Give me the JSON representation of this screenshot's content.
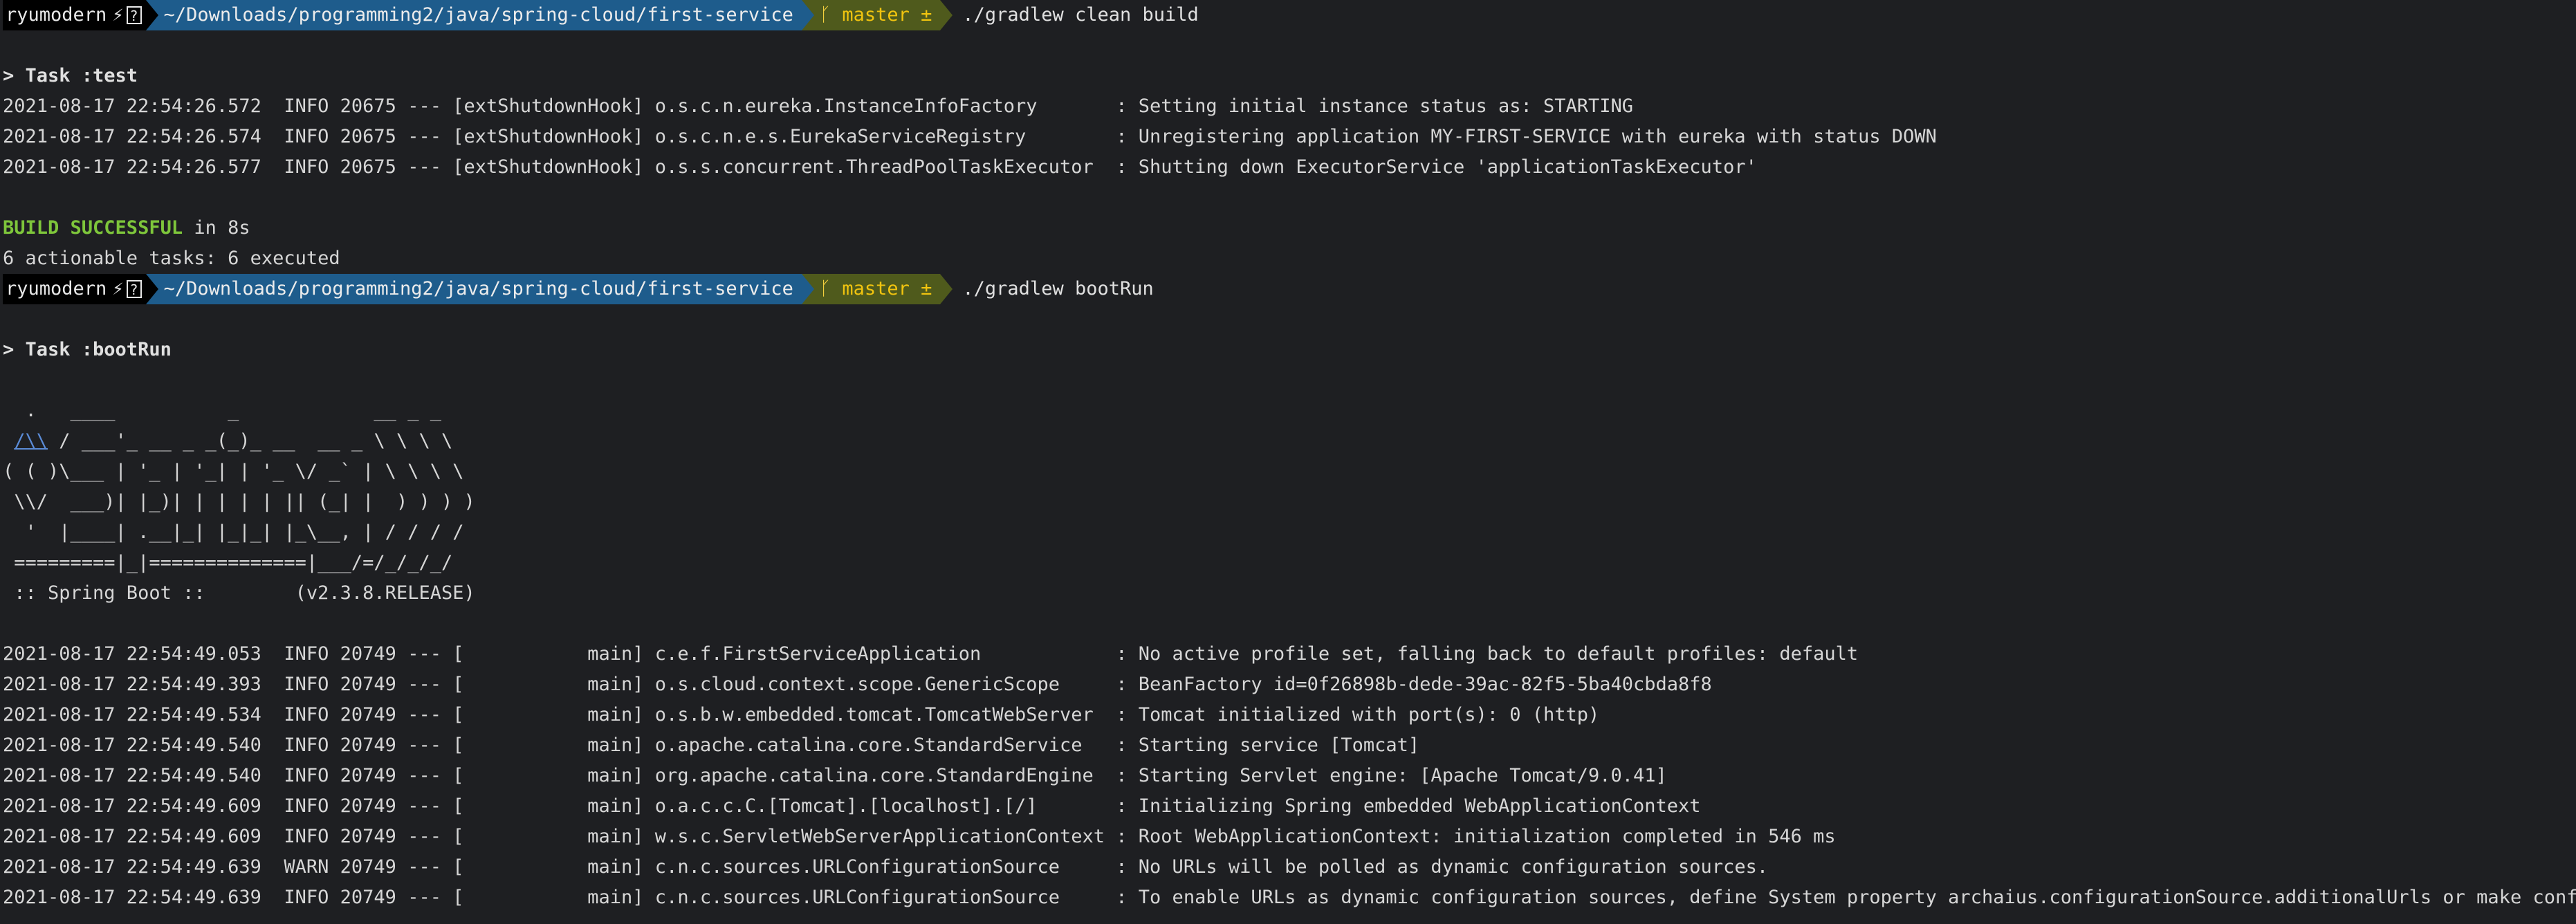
{
  "prompt1": {
    "user": "ryumodern",
    "status_symbol": "⚡",
    "status_box": "?",
    "directory": "~/Downloads/programming2/java/spring-cloud/first-service",
    "git_icon": "ᚴ",
    "branch": "master ±",
    "command": "./gradlew clean build"
  },
  "task_test": "> Task :test",
  "log_test": [
    "2021-08-17 22:54:26.572  INFO 20675 --- [extShutdownHook] o.s.c.n.eureka.InstanceInfoFactory       : Setting initial instance status as: STARTING",
    "2021-08-17 22:54:26.574  INFO 20675 --- [extShutdownHook] o.s.c.n.e.s.EurekaServiceRegistry        : Unregistering application MY-FIRST-SERVICE with eureka with status DOWN",
    "2021-08-17 22:54:26.577  INFO 20675 --- [extShutdownHook] o.s.s.concurrent.ThreadPoolTaskExecutor  : Shutting down ExecutorService 'applicationTaskExecutor'"
  ],
  "build_result": {
    "status": "BUILD SUCCESSFUL",
    "time": " in 8s",
    "tasks": "6 actionable tasks: 6 executed"
  },
  "prompt2": {
    "user": "ryumodern",
    "status_symbol": "⚡",
    "status_box": "?",
    "directory": "~/Downloads/programming2/java/spring-cloud/first-service",
    "git_icon": "ᚴ",
    "branch": "master ±",
    "command": "./gradlew bootRun"
  },
  "task_bootrun": "> Task :bootRun",
  "banner": {
    "line1": "  .   ____          _            __ _ _",
    "line2_accent": "/\\\\",
    "line2_rest": " / ___'_ __ _ _(_)_ __  __ _ \\ \\ \\ \\",
    "line3": "( ( )\\___ | '_ | '_| | '_ \\/ _` | \\ \\ \\ \\",
    "line4": " \\\\/  ___)| |_)| | | | | || (_| |  ) ) ) )",
    "line5": "  '  |____| .__|_| |_|_| |_\\__, | / / / /",
    "line6": " =========|_|==============|___/=/_/_/_/",
    "line7": " :: Spring Boot ::        (v2.3.8.RELEASE)"
  },
  "log_bootrun": [
    "2021-08-17 22:54:49.053  INFO 20749 --- [           main] c.e.f.FirstServiceApplication            : No active profile set, falling back to default profiles: default",
    "2021-08-17 22:54:49.393  INFO 20749 --- [           main] o.s.cloud.context.scope.GenericScope     : BeanFactory id=0f26898b-dede-39ac-82f5-5ba40cbda8f8",
    "2021-08-17 22:54:49.534  INFO 20749 --- [           main] o.s.b.w.embedded.tomcat.TomcatWebServer  : Tomcat initialized with port(s): 0 (http)",
    "2021-08-17 22:54:49.540  INFO 20749 --- [           main] o.apache.catalina.core.StandardService   : Starting service [Tomcat]",
    "2021-08-17 22:54:49.540  INFO 20749 --- [           main] org.apache.catalina.core.StandardEngine  : Starting Servlet engine: [Apache Tomcat/9.0.41]",
    "2021-08-17 22:54:49.609  INFO 20749 --- [           main] o.a.c.c.C.[Tomcat].[localhost].[/]       : Initializing Spring embedded WebApplicationContext",
    "2021-08-17 22:54:49.609  INFO 20749 --- [           main] w.s.c.ServletWebServerApplicationContext : Root WebApplicationContext: initialization completed in 546 ms",
    "2021-08-17 22:54:49.639  WARN 20749 --- [           main] c.n.c.sources.URLConfigurationSource     : No URLs will be polled as dynamic configuration sources.",
    "2021-08-17 22:54:49.639  INFO 20749 --- [           main] c.n.c.sources.URLConfigurationSource     : To enable URLs as dynamic configuration sources, define System property archaius.configurationSource.additionalUrls or make config."
  ]
}
